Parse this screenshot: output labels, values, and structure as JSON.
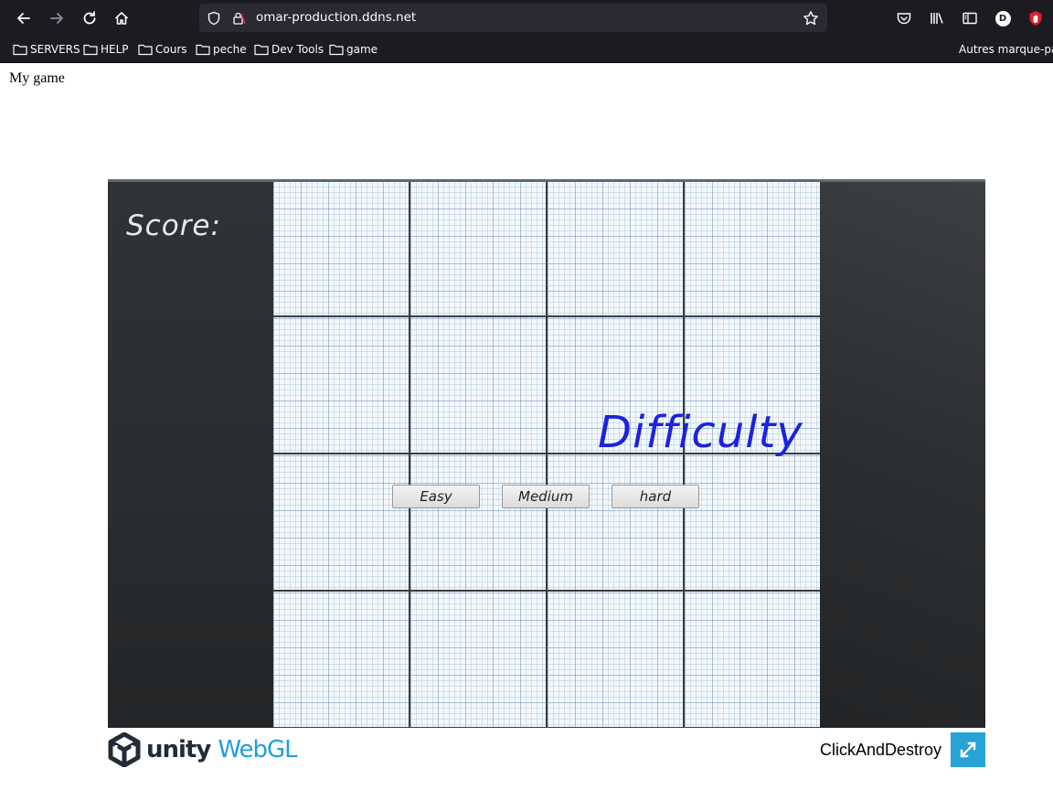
{
  "browser": {
    "url": "omar-production.ddns.net",
    "bookmarks": [
      {
        "label": "SERVERS"
      },
      {
        "label": "HELP"
      },
      {
        "label": "Cours"
      },
      {
        "label": "peche"
      },
      {
        "label": "Dev Tools"
      },
      {
        "label": "game"
      }
    ],
    "other_bookmarks": "Autres marque-pages",
    "profile_initial": "D",
    "icons": [
      "back-icon",
      "forward-icon",
      "reload-icon",
      "home-icon",
      "shield-icon",
      "lock-icon",
      "star-icon",
      "pocket-icon",
      "library-icon",
      "sidebar-icon",
      "account-icon",
      "extension-icon",
      "folder-icon"
    ]
  },
  "page": {
    "title": "My game"
  },
  "game": {
    "score_label": "Score:",
    "heading": "Difficulty",
    "buttons": [
      "Easy",
      "Medium",
      "hard"
    ],
    "colors": {
      "heading": "#1b22e0",
      "sidebar": "#2a2c2e",
      "paper": "#f4f8fb"
    }
  },
  "footer": {
    "unity": "unity",
    "webgl": "WebGL",
    "game_name": "ClickAndDestroy",
    "colors": {
      "webgl": "#1fa0d6",
      "fullscreen": "#27a2d5"
    }
  }
}
